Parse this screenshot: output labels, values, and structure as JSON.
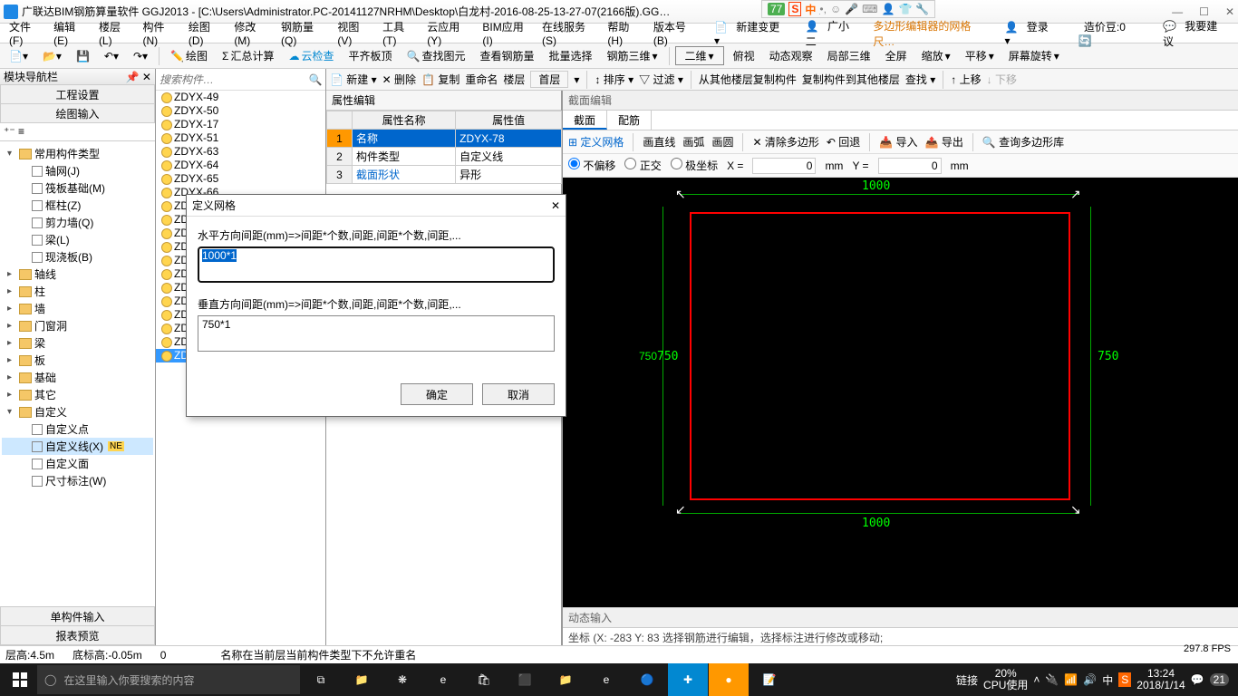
{
  "title": "广联达BIM钢筋算量软件 GGJ2013 - [C:\\Users\\Administrator.PC-20141127NRHM\\Desktop\\白龙村-2016-08-25-13-27-07(2166版).GG…",
  "ime": {
    "badge": "77",
    "label": "中"
  },
  "menu": [
    "文件(F)",
    "编辑(E)",
    "楼层(L)",
    "构件(N)",
    "绘图(D)",
    "修改(M)",
    "钢筋量(Q)",
    "视图(V)",
    "工具(T)",
    "云应用(Y)",
    "BIM应用(I)",
    "在线服务(S)",
    "帮助(H)",
    "版本号(B)"
  ],
  "menu_right": {
    "new_change": "新建变更",
    "name": "广小二",
    "marquee": "多边形编辑器的网格尺…",
    "login": "登录",
    "price": "造价豆:0",
    "suggest": "我要建议"
  },
  "toolbar1": [
    "绘图",
    "汇总计算",
    "云检查",
    "平齐板顶",
    "查找图元",
    "查看钢筋量",
    "批量选择",
    "钢筋三维",
    "二维",
    "俯视",
    "动态观察",
    "局部三维",
    "全屏",
    "缩放",
    "平移",
    "屏幕旋转"
  ],
  "left": {
    "panel_title": "模块导航栏",
    "tab1": "工程设置",
    "tab2": "绘图输入",
    "bottom1": "单构件输入",
    "bottom2": "报表预览",
    "nodes": [
      {
        "l": 1,
        "t": "常用构件类型",
        "exp": true
      },
      {
        "l": 2,
        "t": "轴网(J)"
      },
      {
        "l": 2,
        "t": "筏板基础(M)"
      },
      {
        "l": 2,
        "t": "框柱(Z)"
      },
      {
        "l": 2,
        "t": "剪力墙(Q)"
      },
      {
        "l": 2,
        "t": "梁(L)"
      },
      {
        "l": 2,
        "t": "现浇板(B)"
      },
      {
        "l": 1,
        "t": "轴线"
      },
      {
        "l": 1,
        "t": "柱"
      },
      {
        "l": 1,
        "t": "墙"
      },
      {
        "l": 1,
        "t": "门窗洞"
      },
      {
        "l": 1,
        "t": "梁"
      },
      {
        "l": 1,
        "t": "板"
      },
      {
        "l": 1,
        "t": "基础"
      },
      {
        "l": 1,
        "t": "其它"
      },
      {
        "l": 1,
        "t": "自定义",
        "exp": true
      },
      {
        "l": 2,
        "t": "自定义点"
      },
      {
        "l": 2,
        "t": "自定义线(X)",
        "sel": true,
        "new": true
      },
      {
        "l": 2,
        "t": "自定义面"
      },
      {
        "l": 2,
        "t": "尺寸标注(W)"
      }
    ]
  },
  "mid": {
    "tb": [
      "新建",
      "删除",
      "复制",
      "重命名",
      "楼层",
      "首层"
    ],
    "search_ph": "搜索构件…",
    "items": [
      "ZDYX-49",
      "ZDYX-50",
      "ZDYX-17",
      "ZDYX-51",
      "ZDYX-63",
      "ZDYX-64",
      "ZDYX-65",
      "ZDYX-66",
      "ZDYX-67",
      "ZDYX-68",
      "ZDYX-69",
      "ZDYX-70",
      "ZDYX-71",
      "ZDYX-72",
      "ZDYX-73",
      "ZDYX-74",
      "ZDYX-75",
      "ZDYX-76",
      "ZDYX-77",
      "ZDYX-78"
    ],
    "sel": "ZDYX-78"
  },
  "center_tb": [
    "排序",
    "过滤",
    "从其他楼层复制构件",
    "复制构件到其他楼层",
    "查找",
    "上移",
    "下移"
  ],
  "prop": {
    "title": "属性编辑",
    "header": [
      "属性名称",
      "属性值"
    ],
    "rows": [
      {
        "n": "1",
        "k": "名称",
        "v": "ZDYX-78",
        "sel": true
      },
      {
        "n": "2",
        "k": "构件类型",
        "v": "自定义线"
      },
      {
        "n": "3",
        "k": "截面形状",
        "v": "异形"
      }
    ]
  },
  "right": {
    "title": "截面编辑",
    "tabs": [
      "截面",
      "配筋"
    ],
    "rtb": [
      "定义网格",
      "画直线",
      "画弧",
      "画圆",
      "清除多边形",
      "回退",
      "导入",
      "导出",
      "查询多边形库"
    ],
    "coord": {
      "opt1": "不偏移",
      "opt2": "正交",
      "opt3": "极坐标",
      "x_label": "X =",
      "x_val": "0",
      "y_label": "Y =",
      "y_val": "0",
      "unit": "mm"
    },
    "dims": {
      "top": "1000",
      "bottom": "1000",
      "left": "750",
      "left2": "750",
      "right": "750"
    },
    "dyn": "动态输入",
    "status": "坐标 (X: -283 Y: 83  选择钢筋进行编辑，选择标注进行修改或移动;",
    "fps": "297.8 FPS"
  },
  "dialog": {
    "title": "定义网格",
    "label1": "水平方向间距(mm)=>间距*个数,间距,间距*个数,间距,...",
    "val1": "1000*1",
    "label2": "垂直方向间距(mm)=>间距*个数,间距,间距*个数,间距,...",
    "val2": "750*1",
    "ok": "确定",
    "cancel": "取消"
  },
  "bottom": {
    "floor": "层高:4.5m",
    "bottom_h": "底标高:-0.05m",
    "o": "0",
    "msg": "名称在当前层当前构件类型下不允许重名"
  },
  "taskbar": {
    "search": "在这里输入你要搜索的内容",
    "link": "链接",
    "cpu": "20%",
    "cpu_lbl": "CPU使用",
    "time": "13:24",
    "date": "2018/1/14",
    "badge": "21"
  },
  "chart_data": {
    "type": "rectangle-section",
    "width_mm": 1000,
    "height_mm": 750,
    "note": "Red rectangle section 1000×750 mm with green dimension annotations in CAD-style black canvas"
  }
}
